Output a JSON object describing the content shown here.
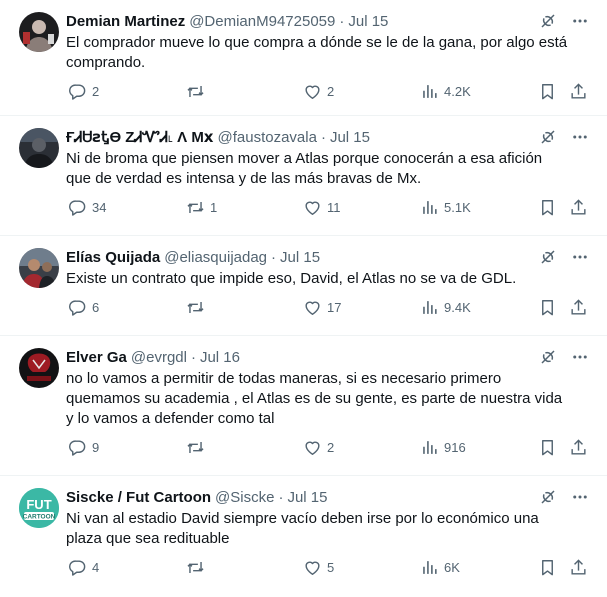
{
  "tweets": [
    {
      "name": "Demian Martinez",
      "handle": "@DemianM94725059",
      "dot": "·",
      "date": "Jul 15",
      "text": "El comprador mueve lo que compra a dónde se le de la gana, por algo está comprando.",
      "replies": "2",
      "retweets": "",
      "likes": "2",
      "views": "4.2K"
    },
    {
      "name": "ҒᏗᏌꙅᎿϴ ZᏗᏉᏗ˪ Ʌ Mⅹ",
      "handle": "@faustozavala",
      "dot": "·",
      "date": "Jul 15",
      "text": "Ni de broma que piensen mover a Atlas porque conocerán a esa afición que de verdad es intensa y de las más bravas de Mx.",
      "replies": "34",
      "retweets": "1",
      "likes": "11",
      "views": "5.1K"
    },
    {
      "name": "Elías Quijada",
      "handle": "@eliasquijadag",
      "dot": "·",
      "date": "Jul 15",
      "text": "Existe un contrato que impide eso, David, el Atlas no se va de GDL.",
      "replies": "6",
      "retweets": "",
      "likes": "17",
      "views": "9.4K"
    },
    {
      "name": "Elver Ga",
      "handle": "@evrgdl",
      "dot": "·",
      "date": "Jul 16",
      "text": "no lo vamos a permitir de todas maneras, si es necesario primero quemamos su academia , el Atlas es de su gente, es parte de nuestra vida y lo vamos a defender como tal",
      "replies": "9",
      "retweets": "",
      "likes": "2",
      "views": "916"
    },
    {
      "name": "Siscke / Fut Cartoon",
      "handle": "@Siscke",
      "dot": "·",
      "date": "Jul 15",
      "text": "Ni van al estadio David siempre vacío deben irse por lo económico una plaza que sea redituable",
      "replies": "4",
      "retweets": "",
      "likes": "5",
      "views": "6K",
      "avatar_text_top": "FUT",
      "avatar_text_bottom": "CARTOON"
    }
  ],
  "colors": {
    "text": "#0f1419",
    "secondary": "#536471",
    "divider": "#eff3f4",
    "fut_cartoon_bg": "#3bb8a5"
  },
  "icons": [
    "grok-icon",
    "more-icon",
    "reply-icon",
    "retweet-icon",
    "like-icon",
    "views-icon",
    "bookmark-icon",
    "share-icon"
  ]
}
